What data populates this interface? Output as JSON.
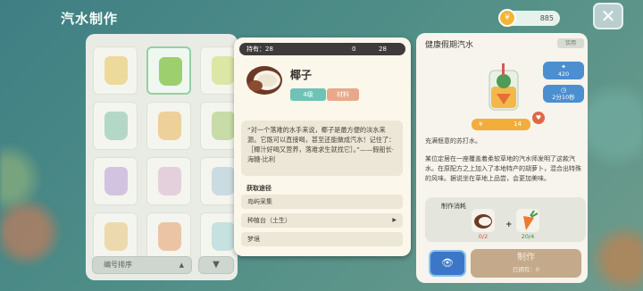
{
  "header": {
    "title": "汽水制作",
    "coins": "885",
    "coin_icon": "coin-icon",
    "close_icon": "close-icon"
  },
  "inventory": {
    "sort_label": "编号排序",
    "sort_arrow": "▲",
    "filter_icon": "▼",
    "cells": [
      {
        "color": "#e6c15a"
      },
      {
        "color": "#9ecf6e"
      },
      {
        "color": "#c9d86a"
      },
      {
        "color": "#7fc0a8"
      },
      {
        "color": "#e8b056"
      },
      {
        "color": "#a3c66b"
      },
      {
        "color": "#b69bd6"
      },
      {
        "color": "#d7b0cf"
      },
      {
        "color": "#a7c7d8"
      },
      {
        "color": "#e6c27a"
      },
      {
        "color": "#e39a6b"
      },
      {
        "color": "#9fd0d6"
      }
    ]
  },
  "popup": {
    "owned_label": "持有：28",
    "stat_1": "0",
    "stat_2": "28",
    "name": "椰子",
    "level": "4级",
    "type": "材料",
    "quote": "“对一个落难的水手来说，椰子是最方便的淡水来源。它既可以直接喝，甚至还能做成汽水！记住了：［椰汁好喝又营养，落难求生就找它］。”——假船长·海糖·比利",
    "acquire_title": "获取途径",
    "acquire": [
      {
        "label": "岛屿采集",
        "arrow": ""
      },
      {
        "label": "种植台（土生）",
        "arrow": "▶"
      },
      {
        "label": "梦境",
        "arrow": ""
      }
    ]
  },
  "detail": {
    "title": "健康假期汽水",
    "tag": "饮用",
    "stat_value": "420",
    "stat_time": "2分10秒",
    "price": "14",
    "desc_1": "充满惬意的苏打水。",
    "desc_2": "某位定居在一座覆盖着柔软草地的汽水师发明了这款汽水。在原配方之上加入了本地特产的胡萝卜，混合出特殊的风味。据说坐在草地上品尝，会更加美味。",
    "consume_title": "制作消耗",
    "materials": [
      {
        "name": "coconut",
        "count": "0/2",
        "color": "#e0463c"
      },
      {
        "name": "carrot",
        "count": "20/4",
        "color": "#3a8a48"
      }
    ],
    "make_label": "制作",
    "make_sub": "已拥有：0",
    "view_icon": "eye-icon"
  }
}
